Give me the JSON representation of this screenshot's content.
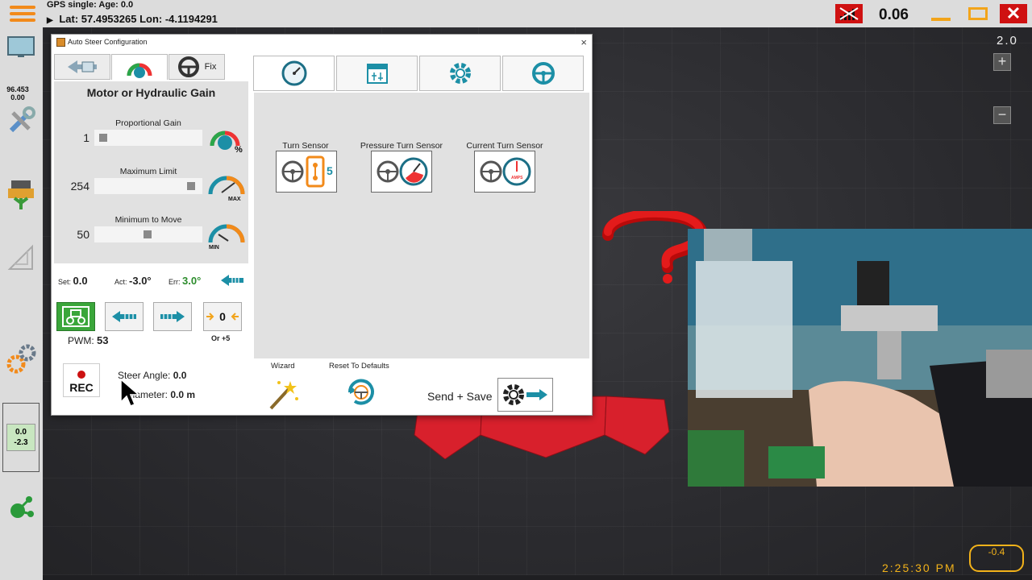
{
  "topbar": {
    "gps_status": "GPS single: Age: 0.0",
    "lat": "Lat: 57.4953265",
    "lon": "Lon: -4.1194291",
    "value": "0.06"
  },
  "left_toolbar": {
    "readout_top": "96.453",
    "readout_bottom": "0.00",
    "box_top": "0.0",
    "box_bottom": "-2.3"
  },
  "map": {
    "zoom_level": "2.0",
    "zoom_in": "+",
    "zoom_out": "−",
    "clock": "2:25:30 PM",
    "gauge_value": "-0.4"
  },
  "dialog": {
    "title": "Auto Steer Configuration",
    "close": "×",
    "fix_tab_label": "Fix",
    "heading": "Motor or Hydraulic Gain",
    "sliders": [
      {
        "label": "Proportional Gain",
        "value": "1",
        "fraction": 0.02
      },
      {
        "label": "Maximum Limit",
        "value": "254",
        "fraction": 0.96
      },
      {
        "label": "Minimum to Move",
        "value": "50",
        "fraction": 0.49
      }
    ],
    "status": {
      "set_label": "Set:",
      "set_value": "0.0",
      "act_label": "Act:",
      "act_value": "-3.0°",
      "err_label": "Err:",
      "err_value": "3.0°"
    },
    "zero_button": "0",
    "pwm_label": "PWM:",
    "pwm_value": "53",
    "or_plus": "Or +5",
    "rec_label": "REC",
    "steer_angle_label": "Steer Angle:",
    "steer_angle_value": "0.0",
    "diameter_label": "Diameter:",
    "diameter_value": "0.0 m",
    "sensors": [
      {
        "label": "Turn Sensor",
        "badge": "5"
      },
      {
        "label": "Pressure Turn Sensor"
      },
      {
        "label": "Current Turn Sensor",
        "badge": "AMPS"
      }
    ],
    "wizard_label": "Wizard",
    "reset_label": "Reset To Defaults",
    "send_save_label": "Send + Save"
  },
  "colors": {
    "accent_orange": "#f28a1a",
    "alert_red": "#cf1111",
    "teal": "#1c8fa6",
    "err_green": "#2c8c2c",
    "clock_yellow": "#f2b21a"
  }
}
